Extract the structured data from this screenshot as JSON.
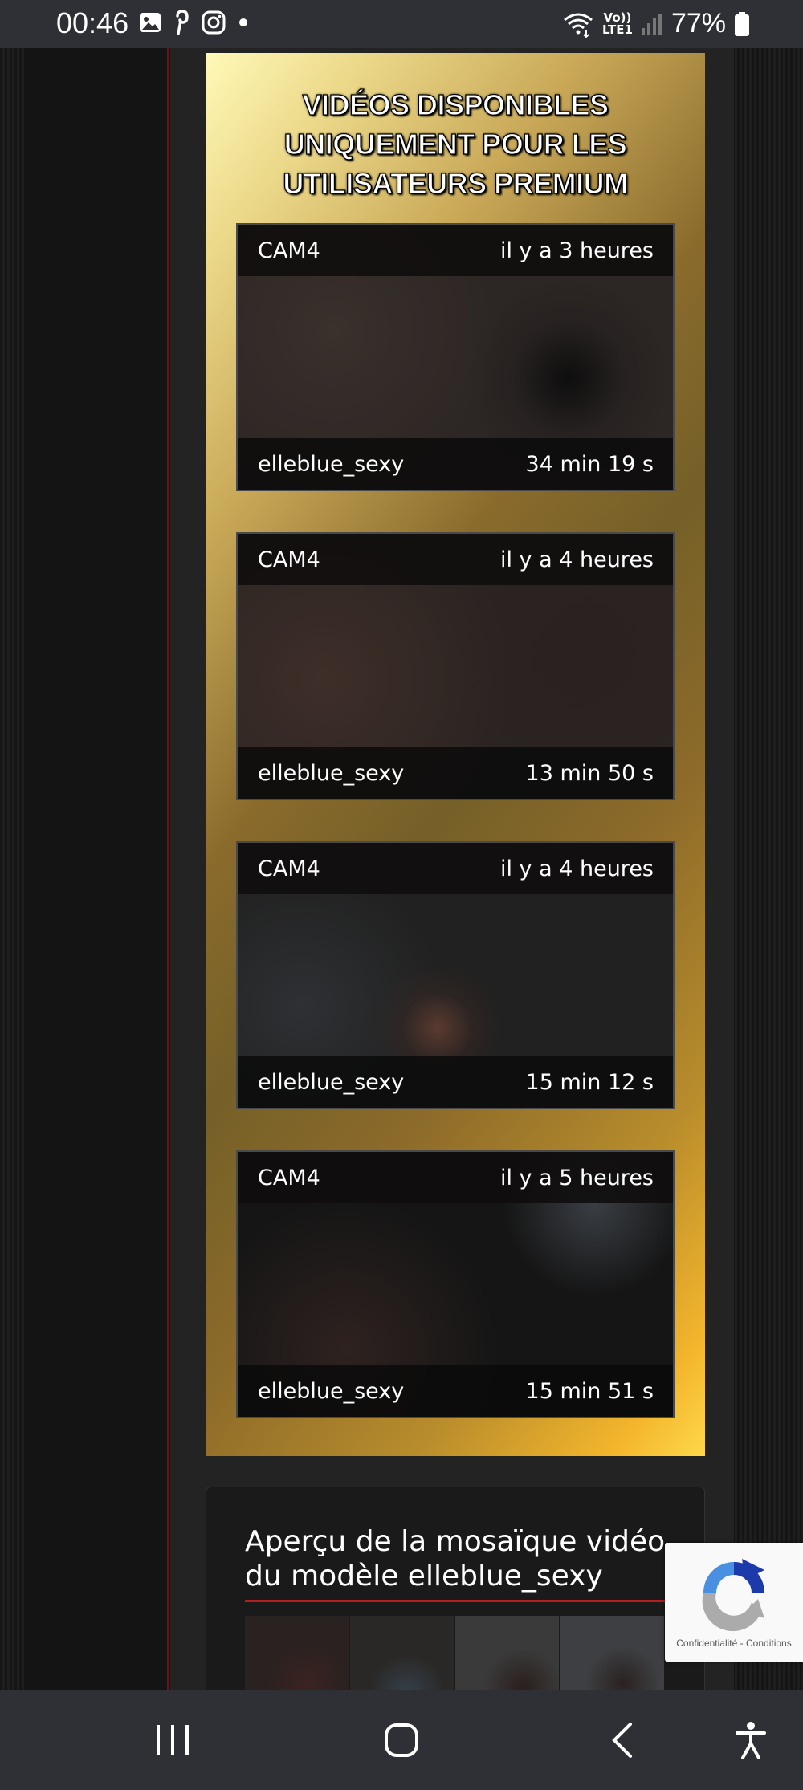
{
  "status_bar": {
    "time": "00:46",
    "left_icons": [
      "gallery-icon",
      "pinterest-icon",
      "instagram-icon",
      "dot-icon"
    ],
    "lte_top": "Vo))",
    "lte_bottom": "LTE1",
    "battery": "77%"
  },
  "premium": {
    "title": "VIDÉOS DISPONIBLES\nUNIQUEMENT POUR LES\nUTILISATEURS PREMIUM",
    "videos": [
      {
        "source": "CAM4",
        "time_ago": "il y a 3 heures",
        "model": "elleblue_sexy",
        "duration": "34 min 19 s"
      },
      {
        "source": "CAM4",
        "time_ago": "il y a 4 heures",
        "model": "elleblue_sexy",
        "duration": "13 min 50 s"
      },
      {
        "source": "CAM4",
        "time_ago": "il y a 4 heures",
        "model": "elleblue_sexy",
        "duration": "15 min 12 s"
      },
      {
        "source": "CAM4",
        "time_ago": "il y a 5 heures",
        "model": "elleblue_sexy",
        "duration": "15 min 51 s"
      }
    ]
  },
  "mosaic": {
    "heading_line1": "Aperçu de la mosaïque vidéo",
    "heading_line2": "du modèle elleblue_sexy"
  },
  "recaptcha": {
    "privacy": "Confidentialité",
    "separator": "-",
    "terms": "Conditions"
  },
  "colors": {
    "status_bar": "#2e3036",
    "accent_red": "#b81c1c",
    "gold": "#c8a857"
  }
}
